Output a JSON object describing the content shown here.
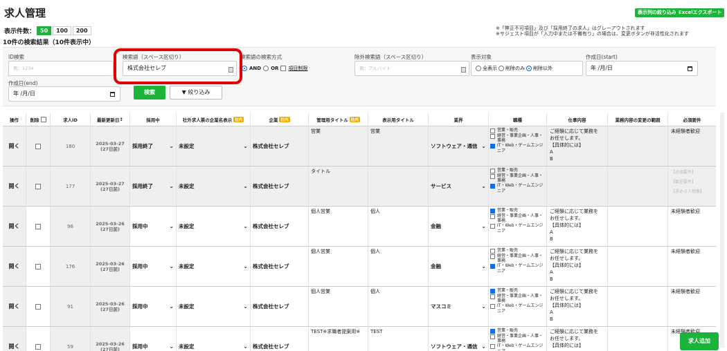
{
  "page_title": "求人管理",
  "header_buttons": {
    "narrow_columns": "表示列の絞り込み",
    "excel_export": "Excelエクスポート"
  },
  "notes": [
    "※「弊正不可項目」及び「採用終了の求人」はグレーアウトされます",
    "※サジェスト項目が「入力中または不備有り」の場合は、変更ボタンが非活性化されます"
  ],
  "display_count": {
    "label": "表示件数：",
    "options": [
      "50",
      "100",
      "200"
    ],
    "selected": "50"
  },
  "result_text": "10件の検索結果（10件表示中）",
  "filters": {
    "id_search": {
      "label": "ID検索",
      "placeholder": "例：1234"
    },
    "keyword": {
      "label": "検索語（スペース区切り）",
      "value": "株式会社セレブ"
    },
    "keyword_mode": {
      "label": "検索語の検索方式",
      "and": "AND",
      "or": "OR",
      "item_limit": "項目制限"
    },
    "exclude_keyword": {
      "label": "除外検索語（スペース区切り）",
      "placeholder": "例：アルバイト"
    },
    "display_target": {
      "label": "表示対象",
      "all": "全表示",
      "deleted_only": "削除のみ",
      "exclude_deleted": "削除以外"
    },
    "created_start": {
      "label": "作成日(start)",
      "value": "年 /月/日"
    },
    "created_end": {
      "label": "作成日(end)",
      "value": "年 /月/日"
    },
    "search_button": "検索",
    "narrow_button": "絞り込み"
  },
  "table": {
    "headers": {
      "op": "操作",
      "del": "削除",
      "id": "求人ID",
      "updated": "最新更新日",
      "status": "採用中",
      "ext_company": "社外求人票の企業名表示",
      "company": "企業",
      "mgmt_title": "管理用タイトル",
      "disp_title": "表示用タイトル",
      "industry": "業界",
      "occupation": "職種",
      "job_desc": "仕事内容",
      "scope_change": "業務内容の変更の範囲",
      "requirements": "必須要件"
    },
    "badge": "社内",
    "open_label": "開く",
    "occupations": [
      "営業・販売",
      "経営・事業企画・人事・事務",
      "IT・Web・ゲームエンジニア"
    ],
    "rows": [
      {
        "id": "180",
        "date": "2025-03-27",
        "ago": "(27日前)",
        "status": "採用終了",
        "ext": "未設定",
        "company": "株式会社セレブ",
        "mgmt": "営業",
        "disp": "営業",
        "industry": "ソフトウェア・通信",
        "occ": [
          false,
          false,
          true
        ],
        "desc": [
          "ご経験に応じて業務を",
          "お任せします。",
          "【具体的には】",
          "A",
          "B"
        ],
        "req": [
          "未経験者歓迎"
        ],
        "grey": true
      },
      {
        "id": "177",
        "date": "2025-03-27",
        "ago": "(27日前)",
        "status": "採用終了",
        "ext": "未設定",
        "company": "株式会社セレブ",
        "mgmt": "タイトル",
        "disp": "",
        "industry": "サービス",
        "occ": [
          false,
          false,
          true
        ],
        "desc": [],
        "req": [
          "【必須要件】",
          "【歓迎要件】",
          "【求める人物像】"
        ],
        "grey": true
      },
      {
        "id": "96",
        "date": "2025-03-26",
        "ago": "(27日前)",
        "status": "採用中",
        "ext": "未設定",
        "company": "株式会社セレブ",
        "mgmt": "個人営業",
        "disp": "個人",
        "industry": "金融",
        "occ": [
          true,
          false,
          false
        ],
        "desc": [
          "ご経験に応じて業務を",
          "お任せします。",
          "【具体的には】",
          "A",
          "B"
        ],
        "req": [
          "未経験者歓迎"
        ],
        "grey": false
      },
      {
        "id": "176",
        "date": "2025-03-26",
        "ago": "(27日前)",
        "status": "採用中",
        "ext": "未設定",
        "company": "株式会社セレブ",
        "mgmt": "個人営業",
        "disp": "個人",
        "industry": "金融",
        "occ": [
          false,
          false,
          true
        ],
        "desc": [
          "ご経験に応じて業務を",
          "お任せします。",
          "【具体的には】",
          "A",
          "B"
        ],
        "req": [
          "未経験者歓迎"
        ],
        "grey": false
      },
      {
        "id": "91",
        "date": "2025-03-26",
        "ago": "(27日前)",
        "status": "採用中",
        "ext": "未設定",
        "company": "株式会社セレブ",
        "mgmt": "個人営業",
        "disp": "個人",
        "industry": "マスコミ",
        "occ": [
          true,
          false,
          false
        ],
        "desc": [
          "ご経験に応じて業務を",
          "お任せします。",
          "【具体的には】",
          "A",
          "B"
        ],
        "req": [
          "未経験者歓迎"
        ],
        "grey": false
      },
      {
        "id": "59",
        "date": "2025-03-26",
        "ago": "(27日前)",
        "status": "採用中",
        "ext": "未設定",
        "company": "株式会社セレブ",
        "mgmt": "TEST※求職者提案用※",
        "disp": "TEST",
        "industry": "ソフトウェア・通信",
        "occ": [
          true,
          false,
          false
        ],
        "desc": [
          "ご経験に応じて業務を",
          "お任せします。",
          "【具体的には】"
        ],
        "req": [
          "未経験者歓迎"
        ],
        "grey": false
      }
    ]
  },
  "add_button": "求人追加"
}
